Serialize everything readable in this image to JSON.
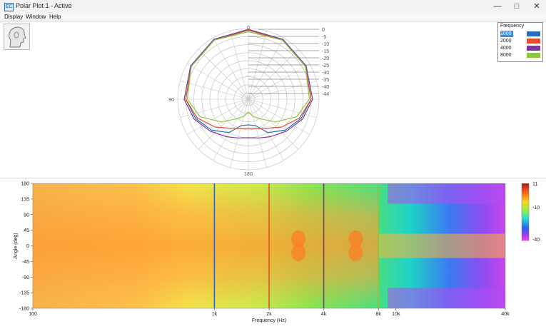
{
  "window": {
    "title": "Polar Plot 1 - Active",
    "minimize_icon": "minimize-icon",
    "maximize_icon": "maximize-icon",
    "close_icon": "close-icon",
    "app_icon_text": "EC"
  },
  "menu": {
    "items": [
      "Display",
      "Window",
      "Help"
    ]
  },
  "head_icon": "head-profile-icon",
  "legend": {
    "title": "Frequency",
    "items": [
      {
        "label": "1000",
        "color": "#2a6db8",
        "selected": true
      },
      {
        "label": "2000",
        "color": "#e0502e",
        "selected": false
      },
      {
        "label": "4000",
        "color": "#7a3a9a",
        "selected": false
      },
      {
        "label": "8000",
        "color": "#8cc63e",
        "selected": false
      }
    ]
  },
  "chart_data": [
    {
      "type": "line",
      "subtype": "polar",
      "angle_labels": [
        "0",
        "90",
        "180"
      ],
      "ring_labels": [
        "0",
        "-5",
        "-10",
        "-15",
        "-20",
        "-25",
        "-30",
        "-35",
        "-40",
        "-44"
      ],
      "rlim": [
        -44,
        0
      ],
      "grid": true,
      "series": [
        {
          "name": "1000",
          "color": "#2a6db8",
          "angles": [
            0,
            30,
            60,
            90,
            110,
            130,
            150,
            165,
            180
          ],
          "values_db": [
            -1,
            -1.5,
            -3,
            -5,
            -9,
            -14,
            -20,
            -27,
            -28
          ]
        },
        {
          "name": "2000",
          "color": "#e0502e",
          "angles": [
            0,
            30,
            60,
            90,
            110,
            130,
            150,
            165,
            180
          ],
          "values_db": [
            -1,
            -1.5,
            -3,
            -5,
            -10,
            -17,
            -23,
            -25,
            -26
          ]
        },
        {
          "name": "4000",
          "color": "#7a3a9a",
          "angles": [
            0,
            30,
            60,
            90,
            110,
            130,
            150,
            165,
            180
          ],
          "values_db": [
            -0.5,
            -1,
            -2.5,
            -4,
            -8,
            -13,
            -17,
            -19,
            -20
          ]
        },
        {
          "name": "8000",
          "color": "#8cc63e",
          "angles": [
            0,
            30,
            60,
            90,
            110,
            130,
            150,
            165,
            180
          ],
          "values_db": [
            -2,
            -1.5,
            -3,
            -6,
            -12,
            -22,
            -30,
            -33,
            -36
          ]
        }
      ]
    },
    {
      "type": "heatmap",
      "xlabel": "Frequency (Hz)",
      "ylabel": "Angle (deg)",
      "xscale": "log",
      "xlim": [
        100,
        40000
      ],
      "ylim": [
        -180,
        180
      ],
      "x_ticks": [
        "100",
        "1k",
        "2k",
        "4k",
        "8k",
        "10k",
        "40k"
      ],
      "x_tick_values": [
        100,
        1000,
        2000,
        4000,
        8000,
        10000,
        40000
      ],
      "y_ticks": [
        "180",
        "135",
        "90",
        "45",
        "0",
        "-45",
        "-90",
        "-135",
        "-180"
      ],
      "y_tick_values": [
        180,
        135,
        90,
        45,
        0,
        -45,
        -90,
        -135,
        -180
      ],
      "marker_lines": [
        {
          "freq": 1000,
          "color": "#2a6db8"
        },
        {
          "freq": 2000,
          "color": "#e0502e"
        },
        {
          "freq": 4000,
          "color": "#7a3a9a"
        },
        {
          "freq": 8000,
          "color": "#8cc63e"
        }
      ],
      "colorbar": {
        "max_label": "11",
        "mid_label": "-10",
        "min_label": "-40",
        "range": [
          -40,
          11
        ]
      }
    }
  ]
}
